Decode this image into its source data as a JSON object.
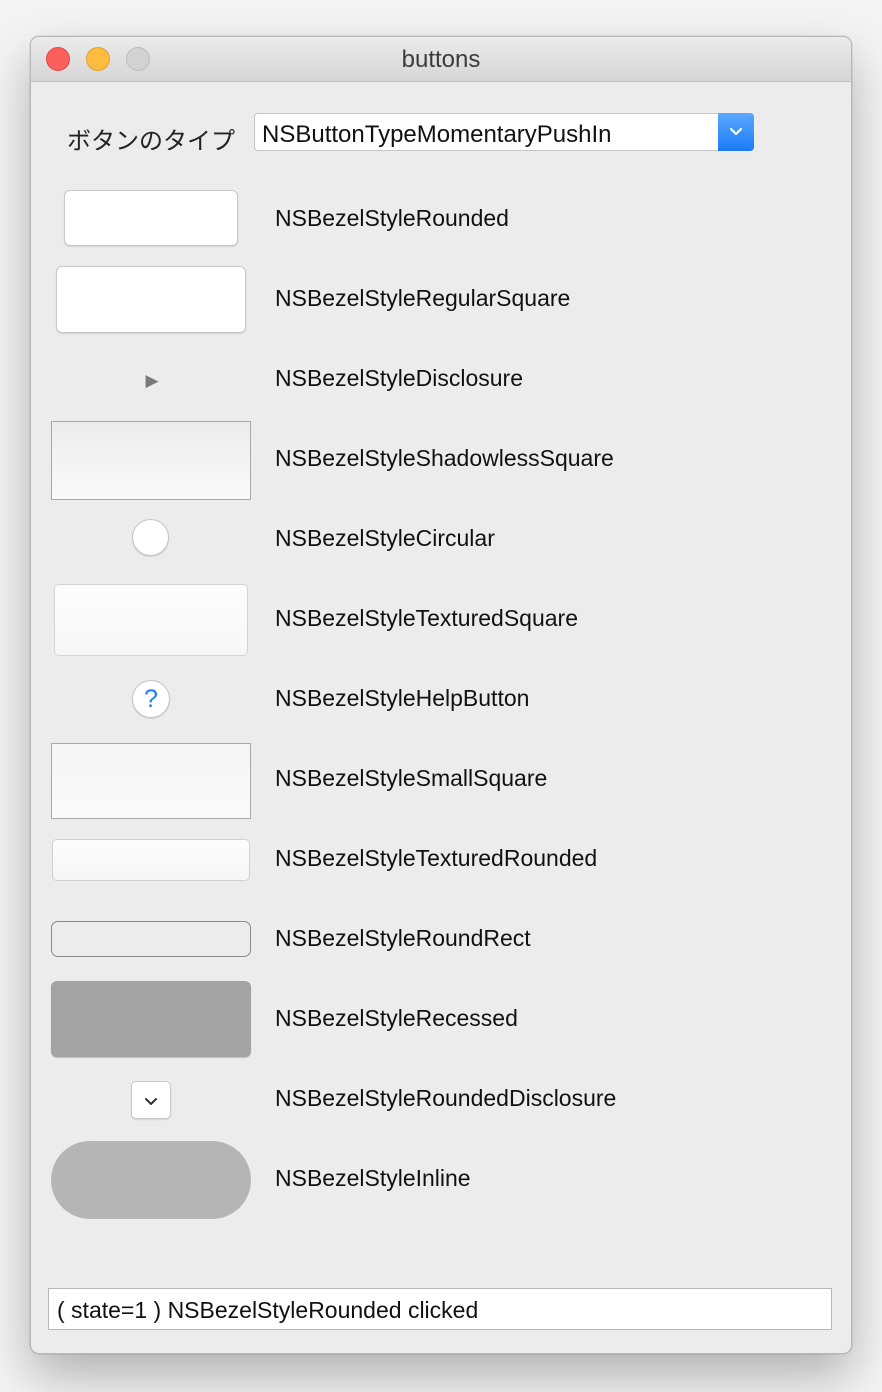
{
  "window": {
    "title": "buttons"
  },
  "button_type": {
    "label": "ボタンのタイプ",
    "selected": "NSButtonTypeMomentaryPushIn"
  },
  "bezel_styles": [
    {
      "label": "NSBezelStyleRounded"
    },
    {
      "label": "NSBezelStyleRegularSquare"
    },
    {
      "label": "NSBezelStyleDisclosure",
      "glyph": "▶"
    },
    {
      "label": "NSBezelStyleShadowlessSquare"
    },
    {
      "label": "NSBezelStyleCircular"
    },
    {
      "label": "NSBezelStyleTexturedSquare"
    },
    {
      "label": "NSBezelStyleHelpButton",
      "glyph": "?"
    },
    {
      "label": "NSBezelStyleSmallSquare"
    },
    {
      "label": "NSBezelStyleTexturedRounded"
    },
    {
      "label": "NSBezelStyleRoundRect"
    },
    {
      "label": "NSBezelStyleRecessed"
    },
    {
      "label": "NSBezelStyleRoundedDisclosure",
      "glyph": "⌄"
    },
    {
      "label": "NSBezelStyleInline"
    }
  ],
  "status": {
    "text": "( state=1 )  NSBezelStyleRounded clicked"
  }
}
